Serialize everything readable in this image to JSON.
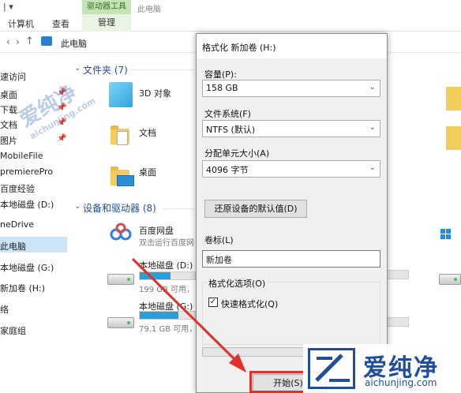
{
  "window": {
    "quick_access": "| ▾",
    "tool_tab": "驱动器工具",
    "title": "此电脑"
  },
  "ribbon": {
    "tabs": [
      "计算机",
      "查看",
      "管理"
    ]
  },
  "address": {
    "back": "‹",
    "forward": "›",
    "up": "↑",
    "crumb": "此电脑"
  },
  "sidebar": {
    "items": [
      "速访问",
      "桌面",
      "下载",
      "文档",
      "图片",
      "MobileFile",
      "premierePro",
      "百度经验",
      "本地磁盘 (D:)",
      "neDrive",
      "此电脑",
      "本地磁盘 (G:)",
      "新加卷 (H:)",
      "络",
      "家庭组"
    ],
    "pin": "📌"
  },
  "main": {
    "folders_header": "文件夹 (7)",
    "folders": [
      "3D 对象",
      "文档",
      "桌面"
    ],
    "devices_header": "设备和驱动器 (8)",
    "devices": [
      {
        "name": "百度网盘",
        "sub": "双击运行百度网"
      },
      {
        "name": "本地磁盘 (D:)",
        "sub": "199 GB 可用，",
        "usage": 0.55
      },
      {
        "name": "本地磁盘 (G:)",
        "sub": "79.1 GB 可用，",
        "usage": 0.7
      }
    ]
  },
  "dialog": {
    "title": "格式化 新加卷 (H:)",
    "capacity_label": "容量(P):",
    "capacity_value": "158 GB",
    "fs_label": "文件系统(F)",
    "fs_value": "NTFS (默认)",
    "unit_label": "分配单元大小(A)",
    "unit_value": "4096 字节",
    "restore_button": "还原设备的默认值(D)",
    "volume_label": "卷标(L)",
    "volume_value": "新加卷",
    "options_label": "格式化选项(O)",
    "quick_format": "快速格式化(Q)",
    "start_button": "开始(S)"
  },
  "watermark": {
    "title": "爱纯净",
    "url": "aichunjing.com"
  },
  "colors": {
    "accent": "#1f4e9c",
    "annotation": "#e0302a",
    "selection": "#cce4f7"
  }
}
